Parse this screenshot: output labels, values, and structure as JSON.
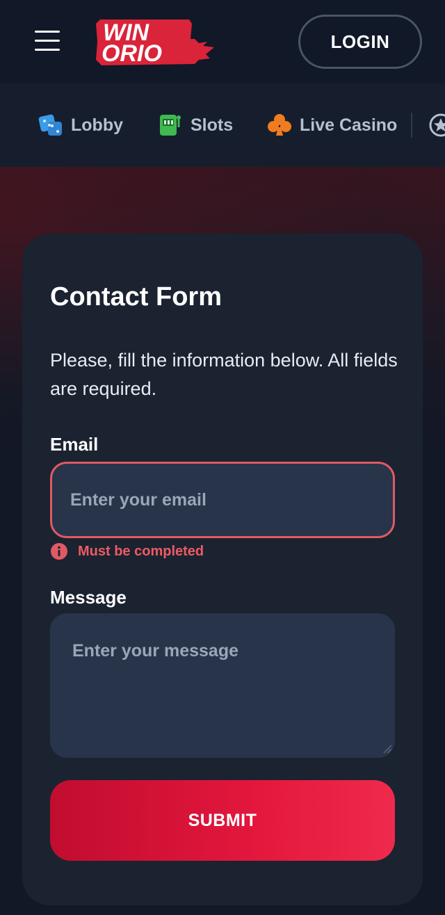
{
  "header": {
    "menu_icon": "hamburger-menu-icon",
    "logo": {
      "line1": "WIN",
      "line2": "ORIO",
      "color": "#d9243a"
    },
    "login_label": "LOGIN"
  },
  "categories": [
    {
      "label": "Lobby",
      "icon": "dice-icon",
      "icon_color": "#3b9be8"
    },
    {
      "label": "Slots",
      "icon": "slot-machine-icon",
      "icon_color": "#3fb950"
    },
    {
      "label": "Live Casino",
      "icon": "club-icon",
      "icon_color": "#f07c1f"
    },
    {
      "label": "",
      "icon": "star-icon",
      "icon_color": "#b6c0d0"
    }
  ],
  "form": {
    "title": "Contact Form",
    "intro": "Please, fill the information below. All fields are required.",
    "email": {
      "label": "Email",
      "value": "",
      "placeholder": "Enter your email",
      "error": "Must be completed"
    },
    "message": {
      "label": "Message",
      "value": "",
      "placeholder": "Enter your message"
    },
    "submit_label": "SUBMIT"
  },
  "colors": {
    "background": "#121826",
    "card": "#1b2230",
    "input": "#27344a",
    "error": "#e05a64",
    "submit": "#e4173d"
  }
}
